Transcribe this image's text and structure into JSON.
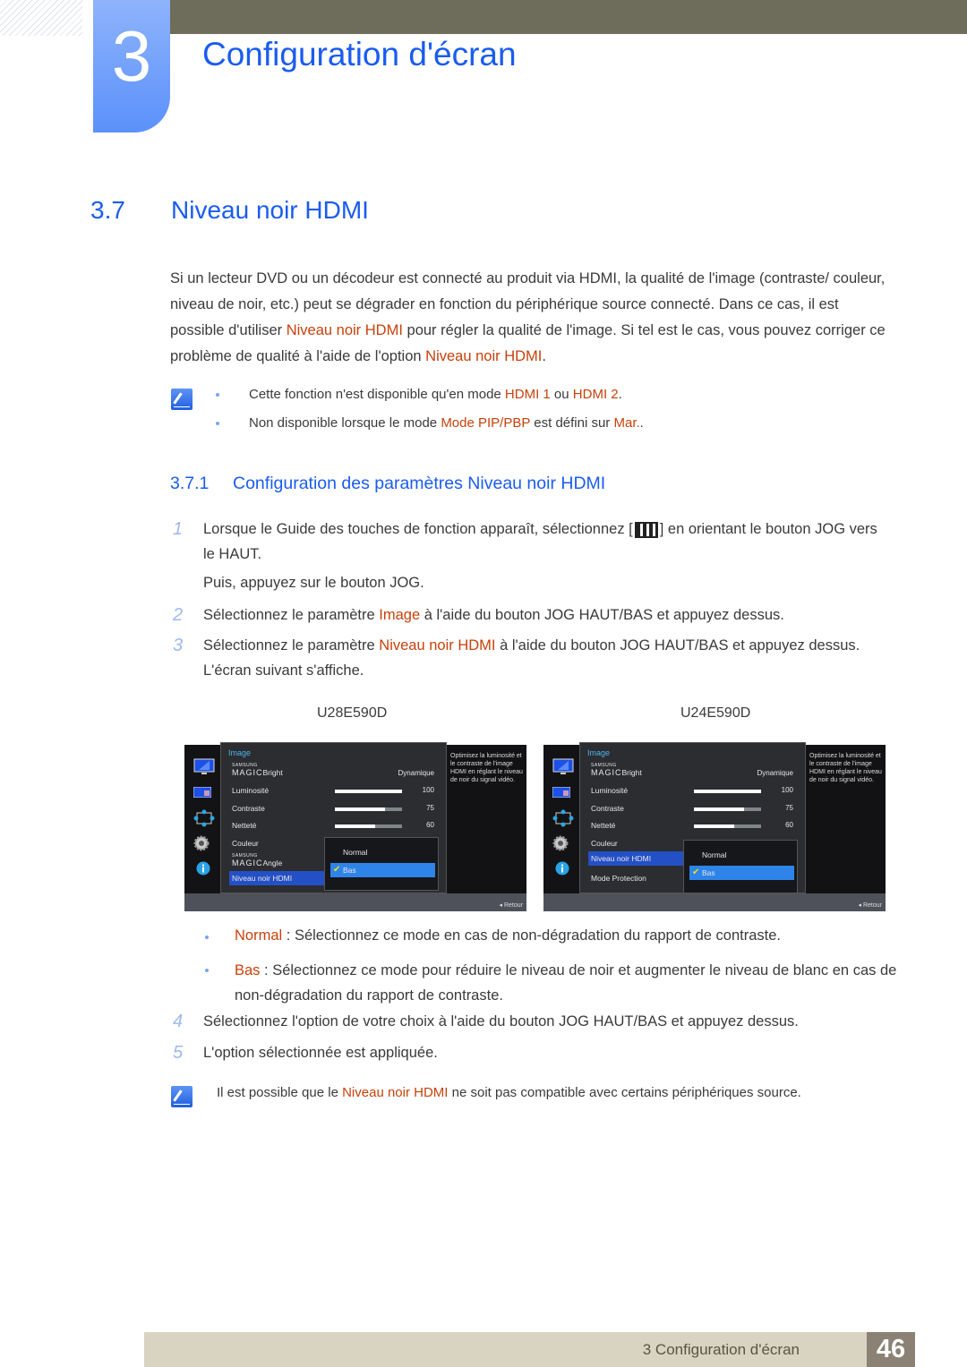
{
  "header": {
    "chapter_number": "3",
    "chapter_title": "Configuration d'écran"
  },
  "section": {
    "number": "3.7",
    "title": "Niveau noir HDMI"
  },
  "intro": {
    "parts": [
      "Si un lecteur DVD ou un décodeur est connecté au produit via HDMI, la qualité de l'image (contraste/ couleur, niveau de noir, etc.) peut se dégrader en fonction du périphérique source connecté. Dans ce cas, il est possible d'utiliser ",
      "Niveau noir HDMI",
      " pour régler la qualité de l'image. Si tel est le cas, vous pouvez corriger ce problème de qualité à l'aide de l'option ",
      "Niveau noir HDMI",
      "."
    ]
  },
  "notes": [
    {
      "parts": [
        "Cette fonction n'est disponible qu'en mode ",
        "HDMI 1",
        " ou ",
        "HDMI 2",
        "."
      ]
    },
    {
      "parts": [
        "Non disponible lorsque le mode ",
        "Mode PIP/PBP",
        " est défini sur ",
        "Mar.",
        "."
      ]
    }
  ],
  "subsection": {
    "number": "3.7.1",
    "title": "Configuration des paramètres Niveau noir HDMI"
  },
  "steps": [
    {
      "num": "1",
      "text_a": "Lorsque le Guide des touches de fonction apparaît, sélectionnez [",
      "text_b": "] en orientant le bouton JOG vers le HAUT.",
      "text_c": "Puis, appuyez sur le bouton JOG."
    },
    {
      "num": "2",
      "parts": [
        "Sélectionnez le paramètre ",
        "Image",
        " à l'aide du bouton JOG HAUT/BAS et appuyez dessus."
      ]
    },
    {
      "num": "3",
      "parts": [
        "Sélectionnez le paramètre ",
        "Niveau noir HDMI",
        " à l'aide du bouton JOG HAUT/BAS et appuyez dessus. L'écran suivant s'affiche."
      ]
    },
    {
      "num": "4",
      "text": "Sélectionnez l'option de votre choix à l'aide du bouton JOG HAUT/BAS et appuyez dessus."
    },
    {
      "num": "5",
      "text": "L'option sélectionnée est appliquée."
    }
  ],
  "screens": [
    {
      "model": "U28E590D",
      "menu_title": "Image",
      "magic_small": "SAMSUNG",
      "magic_big": "MAGIC",
      "rows": [
        {
          "label": "Bright",
          "magic": true,
          "value": "Dynamique"
        },
        {
          "label": "Luminosité",
          "value": "100",
          "level": 1.0
        },
        {
          "label": "Contraste",
          "value": "75",
          "level": 0.75
        },
        {
          "label": "Netteté",
          "value": "60",
          "level": 0.6
        },
        {
          "label": "Couleur"
        },
        {
          "label": "Angle",
          "magic": true
        },
        {
          "label": "Niveau noir HDMI",
          "selected": true
        }
      ],
      "options": [
        "Normal",
        "Bas"
      ],
      "selected_option": "Bas",
      "help": "Optimisez la luminosité et le contraste de l'image HDMI en réglant le niveau de noir du signal vidéo.",
      "back": "Retour"
    },
    {
      "model": "U24E590D",
      "menu_title": "Image",
      "magic_small": "SAMSUNG",
      "magic_big": "MAGIC",
      "rows": [
        {
          "label": "Bright",
          "magic": true,
          "value": "Dynamique"
        },
        {
          "label": "Luminosité",
          "value": "100",
          "level": 1.0
        },
        {
          "label": "Contraste",
          "value": "75",
          "level": 0.75
        },
        {
          "label": "Netteté",
          "value": "60",
          "level": 0.6
        },
        {
          "label": "Couleur"
        },
        {
          "label": "Niveau noir HDMI",
          "selected": true
        },
        {
          "label": "Mode Protection"
        }
      ],
      "options": [
        "Normal",
        "Bas"
      ],
      "selected_option": "Bas",
      "help": "Optimisez la luminosité et le contraste de l'image HDMI en réglant le niveau de noir du signal vidéo.",
      "back": "Retour"
    }
  ],
  "option_descriptions": [
    {
      "term": "Normal",
      "text": " : Sélectionnez ce mode en cas de non-dégradation du rapport de contraste."
    },
    {
      "term": "Bas",
      "text": " : Sélectionnez ce mode pour réduire le niveau de noir et augmenter le niveau de blanc en cas de non-dégradation du rapport de contraste."
    }
  ],
  "final_note": {
    "parts": [
      "Il est possible que le ",
      "Niveau noir HDMI",
      " ne soit pas compatible avec certains périphériques source."
    ]
  },
  "footer": {
    "text": "3 Configuration d'écran",
    "page": "46"
  },
  "colors": {
    "accent_blue": "#1a5cf0",
    "highlight": "#c8410a"
  }
}
